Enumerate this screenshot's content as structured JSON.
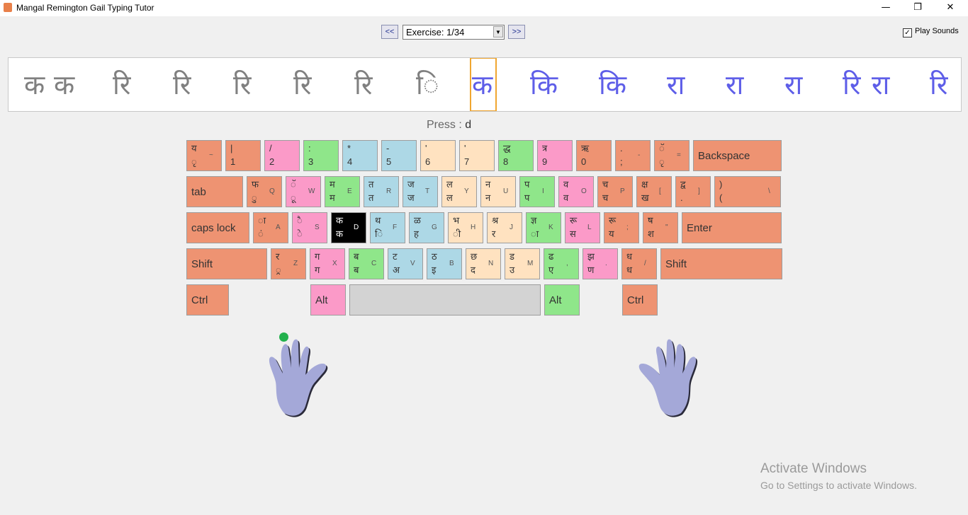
{
  "window": {
    "title": "Mangal Remington Gail Typing Tutor",
    "minimize": "—",
    "restore": "❐",
    "close": "✕"
  },
  "toolbar": {
    "prev_label": "<<",
    "next_label": ">>",
    "exercise_value": "Exercise: 1/34",
    "play_sounds_label": "Play Sounds",
    "play_sounds_checked": true
  },
  "exercise_strip": {
    "typed": [
      "क",
      "क",
      "रि",
      "रि",
      "रि",
      "रि",
      "रि",
      "ि"
    ],
    "current": "क",
    "upcoming": [
      "कि",
      "कि",
      "रा",
      "रा",
      "रा",
      "रि",
      "रा",
      "रि"
    ]
  },
  "prompt": {
    "label": "Press :",
    "key": "d"
  },
  "keyboard": {
    "row1": [
      {
        "top": "य",
        "bottom": "ृ",
        "latin": "~",
        "color": "orange"
      },
      {
        "top": "|",
        "bottom": "1",
        "latin": "",
        "color": "orange"
      },
      {
        "top": "/",
        "bottom": "2",
        "latin": "",
        "color": "pink"
      },
      {
        "top": ":",
        "bottom": "3",
        "latin": "",
        "color": "green"
      },
      {
        "top": "*",
        "bottom": "4",
        "latin": "",
        "color": "blue"
      },
      {
        "top": "-",
        "bottom": "5",
        "latin": "",
        "color": "blue"
      },
      {
        "top": "'",
        "bottom": "6",
        "latin": "",
        "color": "peach"
      },
      {
        "top": "'",
        "bottom": "7",
        "latin": "",
        "color": "peach"
      },
      {
        "top": "द्ध",
        "bottom": "8",
        "latin": "",
        "color": "green"
      },
      {
        "top": "त्र",
        "bottom": "9",
        "latin": "",
        "color": "pink"
      },
      {
        "top": "ऋ",
        "bottom": "0",
        "latin": "",
        "color": "orange"
      },
      {
        "top": ".",
        "bottom": ";",
        "latin": "-",
        "color": "orange"
      },
      {
        "top": "ॅ",
        "bottom": "ृ",
        "latin": "=",
        "color": "orange"
      },
      {
        "word": "Backspace",
        "color": "orange"
      }
    ],
    "row2": [
      {
        "word": "tab",
        "color": "orange"
      },
      {
        "top": "फ",
        "bottom": "ु",
        "latin": "Q",
        "color": "orange"
      },
      {
        "top": "ॅ",
        "bottom": "ू",
        "latin": "W",
        "color": "pink"
      },
      {
        "top": "म",
        "bottom": "म",
        "latin": "E",
        "color": "green"
      },
      {
        "top": "त",
        "bottom": "त",
        "latin": "R",
        "color": "blue"
      },
      {
        "top": "ज",
        "bottom": "ज",
        "latin": "T",
        "color": "blue"
      },
      {
        "top": "ल",
        "bottom": "ल",
        "latin": "Y",
        "color": "peach"
      },
      {
        "top": "न",
        "bottom": "न",
        "latin": "U",
        "color": "peach"
      },
      {
        "top": "प",
        "bottom": "प",
        "latin": "I",
        "color": "green"
      },
      {
        "top": "व",
        "bottom": "व",
        "latin": "O",
        "color": "pink"
      },
      {
        "top": "च",
        "bottom": "च",
        "latin": "P",
        "color": "orange"
      },
      {
        "top": "क्ष",
        "bottom": "ख",
        "latin": "[",
        "color": "orange"
      },
      {
        "top": "द्व",
        "bottom": ".",
        "latin": "]",
        "color": "orange"
      },
      {
        "top": ")",
        "bottom": "(",
        "latin": "\\",
        "color": "orange"
      }
    ],
    "row3": [
      {
        "word": "caps  lock",
        "color": "orange"
      },
      {
        "top": "ा",
        "bottom": "ं",
        "latin": "A",
        "color": "orange"
      },
      {
        "top": "ै",
        "bottom": "े",
        "latin": "S",
        "color": "pink"
      },
      {
        "top": "क",
        "bottom": "क",
        "latin": "D",
        "color": "green",
        "active": true
      },
      {
        "top": "थ",
        "bottom": "ि",
        "latin": "F",
        "color": "blue"
      },
      {
        "top": "ळ",
        "bottom": "ह",
        "latin": "G",
        "color": "blue"
      },
      {
        "top": "भ",
        "bottom": "ी",
        "latin": "H",
        "color": "peach"
      },
      {
        "top": "श्र",
        "bottom": "र",
        "latin": "J",
        "color": "peach"
      },
      {
        "top": "ज्ञ",
        "bottom": "ा",
        "latin": "K",
        "color": "green"
      },
      {
        "top": "रू",
        "bottom": "स",
        "latin": "L",
        "color": "pink"
      },
      {
        "top": "रू",
        "bottom": "य",
        "latin": ";",
        "color": "orange"
      },
      {
        "top": "ष",
        "bottom": "श",
        "latin": "\"",
        "color": "orange"
      },
      {
        "word": "Enter",
        "color": "orange"
      }
    ],
    "row4": [
      {
        "word": "Shift",
        "color": "orange"
      },
      {
        "top": "र",
        "bottom": "्र",
        "latin": "Z",
        "color": "orange"
      },
      {
        "top": "ग",
        "bottom": "ग",
        "latin": "X",
        "color": "pink"
      },
      {
        "top": "ब",
        "bottom": "ब",
        "latin": "C",
        "color": "green"
      },
      {
        "top": "ट",
        "bottom": "अ",
        "latin": "V",
        "color": "blue"
      },
      {
        "top": "ठ",
        "bottom": "इ",
        "latin": "B",
        "color": "blue"
      },
      {
        "top": "छ",
        "bottom": "द",
        "latin": "N",
        "color": "peach"
      },
      {
        "top": "ड",
        "bottom": "उ",
        "latin": "M",
        "color": "peach"
      },
      {
        "top": "ढ",
        "bottom": "ए",
        "latin": ",",
        "color": "green"
      },
      {
        "top": "झ",
        "bottom": "ण",
        "latin": ".",
        "color": "pink"
      },
      {
        "top": "ध",
        "bottom": "ध",
        "latin": "/",
        "color": "orange"
      },
      {
        "word": "Shift",
        "color": "orange"
      }
    ],
    "row5": [
      {
        "word": "Ctrl",
        "color": "orange"
      },
      {
        "word": "Alt",
        "color": "pink"
      },
      {
        "word": "",
        "color": "grey"
      },
      {
        "word": "Alt",
        "color": "green"
      },
      {
        "word": "Ctrl",
        "color": "orange"
      }
    ]
  },
  "hands": {
    "fill": "#a4a8d8",
    "outline": "#2a2a3a",
    "finger_indicator_color": "#23b14d"
  },
  "watermark": {
    "line1": "Activate Windows",
    "line2": "Go to Settings to activate Windows."
  }
}
